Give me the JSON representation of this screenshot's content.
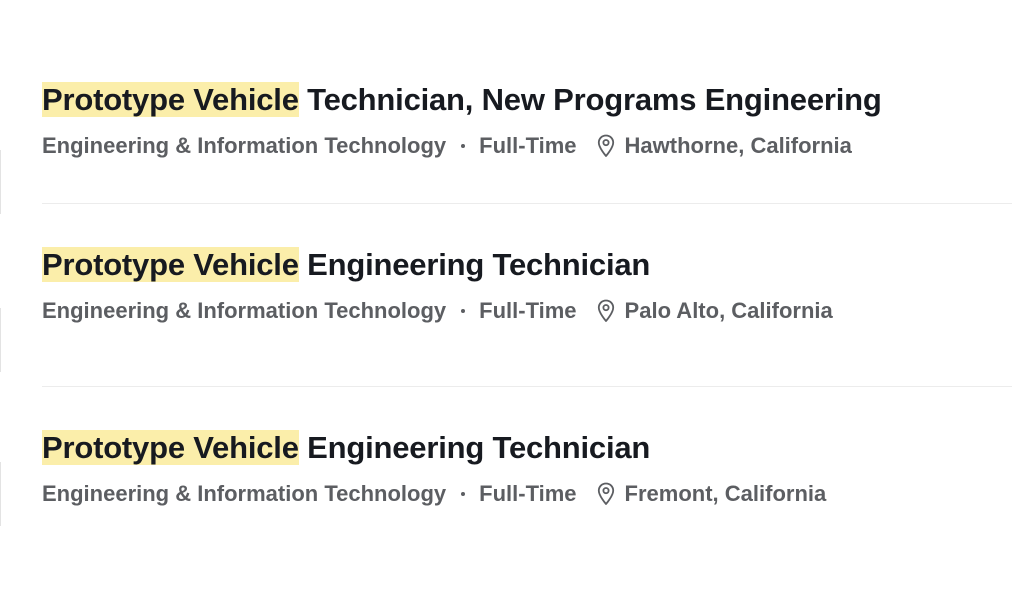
{
  "jobs": [
    {
      "highlight": "Prototype Vehicle",
      "title_rest": " Technician, New Programs Engineering",
      "department": "Engineering & Information Technology",
      "type": "Full-Time",
      "location": "Hawthorne, California"
    },
    {
      "highlight": "Prototype Vehicle",
      "title_rest": " Engineering Technician",
      "department": "Engineering & Information Technology",
      "type": "Full-Time",
      "location": "Palo Alto, California"
    },
    {
      "highlight": "Prototype Vehicle",
      "title_rest": " Engineering Technician",
      "department": "Engineering & Information Technology",
      "type": "Full-Time",
      "location": "Fremont, California"
    }
  ],
  "colors": {
    "highlight": "#fbeeaa",
    "title": "#171a20",
    "meta": "#5c5e62",
    "divider": "#ececec"
  },
  "icons": {
    "location": "location-pin-icon"
  }
}
